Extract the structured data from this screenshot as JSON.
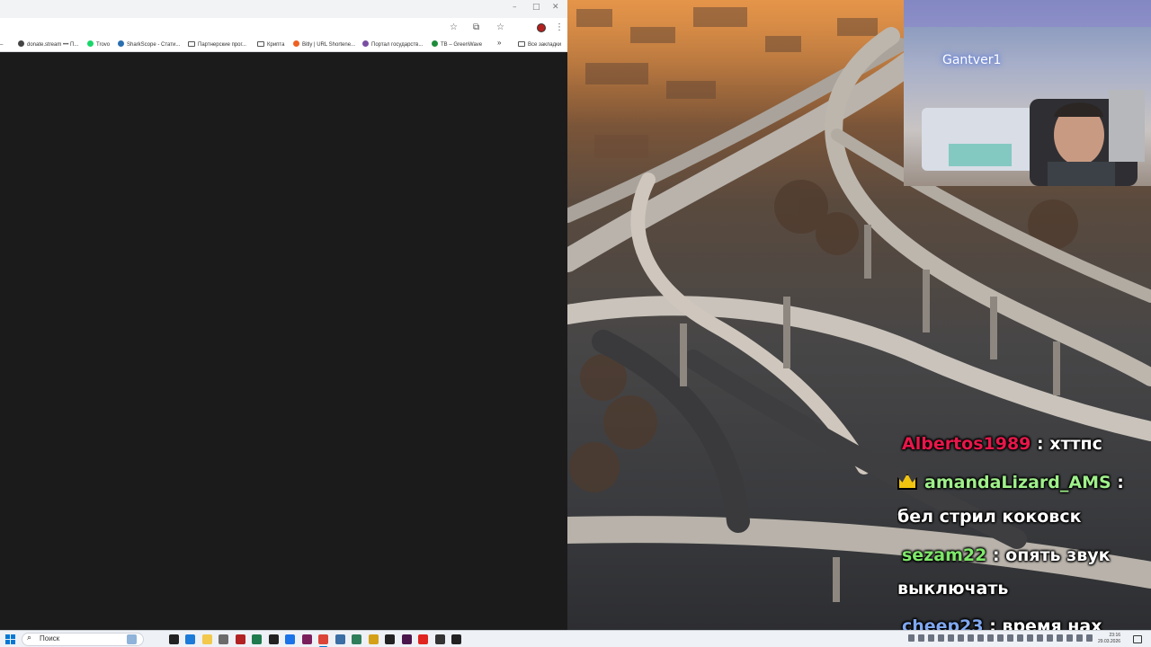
{
  "browser": {
    "window_controls": [
      "–",
      "□",
      "✕"
    ],
    "toolbar_icons": [
      "star-icon",
      "extensions-icon",
      "bookmark-icon",
      "menu-icon"
    ],
    "bookmarks": [
      {
        "label": "donate.stream ••• П...",
        "icon": "donate-icon",
        "color": "#444444"
      },
      {
        "label": "Trovo",
        "icon": "trovo-icon",
        "color": "#19d66b"
      },
      {
        "label": "SharkScope - Стати...",
        "icon": "sharkscope-icon",
        "color": "#2a6fb0"
      },
      {
        "label": "Партнерские прог...",
        "icon": "folder-icon",
        "color": "#555555"
      },
      {
        "label": "Крипта",
        "icon": "folder-icon",
        "color": "#555555"
      },
      {
        "label": "Bitly | URL Shortene...",
        "icon": "bitly-icon",
        "color": "#ee6123"
      },
      {
        "label": "Портал государств...",
        "icon": "gov-icon",
        "color": "#7a4fa3"
      },
      {
        "label": "TB – GreenWave",
        "icon": "greenwave-icon",
        "color": "#1e8c3a"
      }
    ],
    "overflow_label": "»",
    "all_bookmarks_label": "Все закладки"
  },
  "overlay": {
    "webcam_name": "Gantver1"
  },
  "chat": {
    "messages": [
      {
        "nick": "Albertos1989",
        "text": " : хттпс",
        "color": "#e8174a",
        "badge": ""
      },
      {
        "nick": "amandaLizard_AMS",
        "text": " :",
        "color": "#9ff08a",
        "badge": "crown-icon"
      },
      {
        "nick": "",
        "text": "бел стрил коковск",
        "color": "#ffffff",
        "badge": ""
      },
      {
        "nick": "sezam22",
        "text": " : опять звук",
        "color": "#7ee86a",
        "badge": ""
      },
      {
        "nick": "",
        "text": "выключать",
        "color": "#ffffff",
        "badge": ""
      },
      {
        "nick": "cheep23",
        "text": " : время нах",
        "color": "#7fa7f0",
        "badge": ""
      }
    ]
  },
  "taskbar": {
    "search_label": "Поиск",
    "apps": [
      {
        "icon": "lighthouse-icon",
        "color": "#8fb3d9"
      },
      {
        "icon": "task-view-icon",
        "color": "#222222"
      },
      {
        "icon": "edge-icon",
        "color": "#1c7ad9"
      },
      {
        "icon": "explorer-icon",
        "color": "#f2c94c"
      },
      {
        "icon": "tool-icon",
        "color": "#6b6b6b"
      },
      {
        "icon": "cpu-z-icon",
        "color": "#b22222"
      },
      {
        "icon": "terminal-icon",
        "color": "#1f7a4d"
      },
      {
        "icon": "obs-icon",
        "color": "#222222"
      },
      {
        "icon": "chrome-icon",
        "color": "#1a73e8"
      },
      {
        "icon": "app-icon",
        "color": "#7a1f5c"
      },
      {
        "icon": "chrome-profile-icon",
        "color": "#db4437"
      },
      {
        "icon": "calculator-icon",
        "color": "#3a6ea5"
      },
      {
        "icon": "spreadsheet-icon",
        "color": "#2e7d5b"
      },
      {
        "icon": "poker-icon",
        "color": "#d4a017"
      },
      {
        "icon": "vpn-icon",
        "color": "#222222"
      },
      {
        "icon": "app2-icon",
        "color": "#4a154b"
      },
      {
        "icon": "yandex-icon",
        "color": "#e0241f"
      },
      {
        "icon": "app3-icon",
        "color": "#333333"
      },
      {
        "icon": "h-icon",
        "color": "#222222"
      }
    ],
    "clock_time": "23:16",
    "clock_date": "29.03.2026"
  }
}
